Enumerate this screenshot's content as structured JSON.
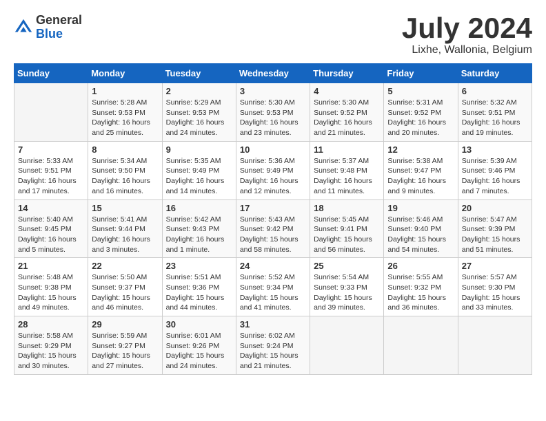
{
  "logo": {
    "general": "General",
    "blue": "Blue"
  },
  "title": "July 2024",
  "location": "Lixhe, Wallonia, Belgium",
  "days_header": [
    "Sunday",
    "Monday",
    "Tuesday",
    "Wednesday",
    "Thursday",
    "Friday",
    "Saturday"
  ],
  "weeks": [
    [
      {
        "num": "",
        "content": ""
      },
      {
        "num": "1",
        "content": "Sunrise: 5:28 AM\nSunset: 9:53 PM\nDaylight: 16 hours\nand 25 minutes."
      },
      {
        "num": "2",
        "content": "Sunrise: 5:29 AM\nSunset: 9:53 PM\nDaylight: 16 hours\nand 24 minutes."
      },
      {
        "num": "3",
        "content": "Sunrise: 5:30 AM\nSunset: 9:53 PM\nDaylight: 16 hours\nand 23 minutes."
      },
      {
        "num": "4",
        "content": "Sunrise: 5:30 AM\nSunset: 9:52 PM\nDaylight: 16 hours\nand 21 minutes."
      },
      {
        "num": "5",
        "content": "Sunrise: 5:31 AM\nSunset: 9:52 PM\nDaylight: 16 hours\nand 20 minutes."
      },
      {
        "num": "6",
        "content": "Sunrise: 5:32 AM\nSunset: 9:51 PM\nDaylight: 16 hours\nand 19 minutes."
      }
    ],
    [
      {
        "num": "7",
        "content": "Sunrise: 5:33 AM\nSunset: 9:51 PM\nDaylight: 16 hours\nand 17 minutes."
      },
      {
        "num": "8",
        "content": "Sunrise: 5:34 AM\nSunset: 9:50 PM\nDaylight: 16 hours\nand 16 minutes."
      },
      {
        "num": "9",
        "content": "Sunrise: 5:35 AM\nSunset: 9:49 PM\nDaylight: 16 hours\nand 14 minutes."
      },
      {
        "num": "10",
        "content": "Sunrise: 5:36 AM\nSunset: 9:49 PM\nDaylight: 16 hours\nand 12 minutes."
      },
      {
        "num": "11",
        "content": "Sunrise: 5:37 AM\nSunset: 9:48 PM\nDaylight: 16 hours\nand 11 minutes."
      },
      {
        "num": "12",
        "content": "Sunrise: 5:38 AM\nSunset: 9:47 PM\nDaylight: 16 hours\nand 9 minutes."
      },
      {
        "num": "13",
        "content": "Sunrise: 5:39 AM\nSunset: 9:46 PM\nDaylight: 16 hours\nand 7 minutes."
      }
    ],
    [
      {
        "num": "14",
        "content": "Sunrise: 5:40 AM\nSunset: 9:45 PM\nDaylight: 16 hours\nand 5 minutes."
      },
      {
        "num": "15",
        "content": "Sunrise: 5:41 AM\nSunset: 9:44 PM\nDaylight: 16 hours\nand 3 minutes."
      },
      {
        "num": "16",
        "content": "Sunrise: 5:42 AM\nSunset: 9:43 PM\nDaylight: 16 hours\nand 1 minute."
      },
      {
        "num": "17",
        "content": "Sunrise: 5:43 AM\nSunset: 9:42 PM\nDaylight: 15 hours\nand 58 minutes."
      },
      {
        "num": "18",
        "content": "Sunrise: 5:45 AM\nSunset: 9:41 PM\nDaylight: 15 hours\nand 56 minutes."
      },
      {
        "num": "19",
        "content": "Sunrise: 5:46 AM\nSunset: 9:40 PM\nDaylight: 15 hours\nand 54 minutes."
      },
      {
        "num": "20",
        "content": "Sunrise: 5:47 AM\nSunset: 9:39 PM\nDaylight: 15 hours\nand 51 minutes."
      }
    ],
    [
      {
        "num": "21",
        "content": "Sunrise: 5:48 AM\nSunset: 9:38 PM\nDaylight: 15 hours\nand 49 minutes."
      },
      {
        "num": "22",
        "content": "Sunrise: 5:50 AM\nSunset: 9:37 PM\nDaylight: 15 hours\nand 46 minutes."
      },
      {
        "num": "23",
        "content": "Sunrise: 5:51 AM\nSunset: 9:36 PM\nDaylight: 15 hours\nand 44 minutes."
      },
      {
        "num": "24",
        "content": "Sunrise: 5:52 AM\nSunset: 9:34 PM\nDaylight: 15 hours\nand 41 minutes."
      },
      {
        "num": "25",
        "content": "Sunrise: 5:54 AM\nSunset: 9:33 PM\nDaylight: 15 hours\nand 39 minutes."
      },
      {
        "num": "26",
        "content": "Sunrise: 5:55 AM\nSunset: 9:32 PM\nDaylight: 15 hours\nand 36 minutes."
      },
      {
        "num": "27",
        "content": "Sunrise: 5:57 AM\nSunset: 9:30 PM\nDaylight: 15 hours\nand 33 minutes."
      }
    ],
    [
      {
        "num": "28",
        "content": "Sunrise: 5:58 AM\nSunset: 9:29 PM\nDaylight: 15 hours\nand 30 minutes."
      },
      {
        "num": "29",
        "content": "Sunrise: 5:59 AM\nSunset: 9:27 PM\nDaylight: 15 hours\nand 27 minutes."
      },
      {
        "num": "30",
        "content": "Sunrise: 6:01 AM\nSunset: 9:26 PM\nDaylight: 15 hours\nand 24 minutes."
      },
      {
        "num": "31",
        "content": "Sunrise: 6:02 AM\nSunset: 9:24 PM\nDaylight: 15 hours\nand 21 minutes."
      },
      {
        "num": "",
        "content": ""
      },
      {
        "num": "",
        "content": ""
      },
      {
        "num": "",
        "content": ""
      }
    ]
  ]
}
